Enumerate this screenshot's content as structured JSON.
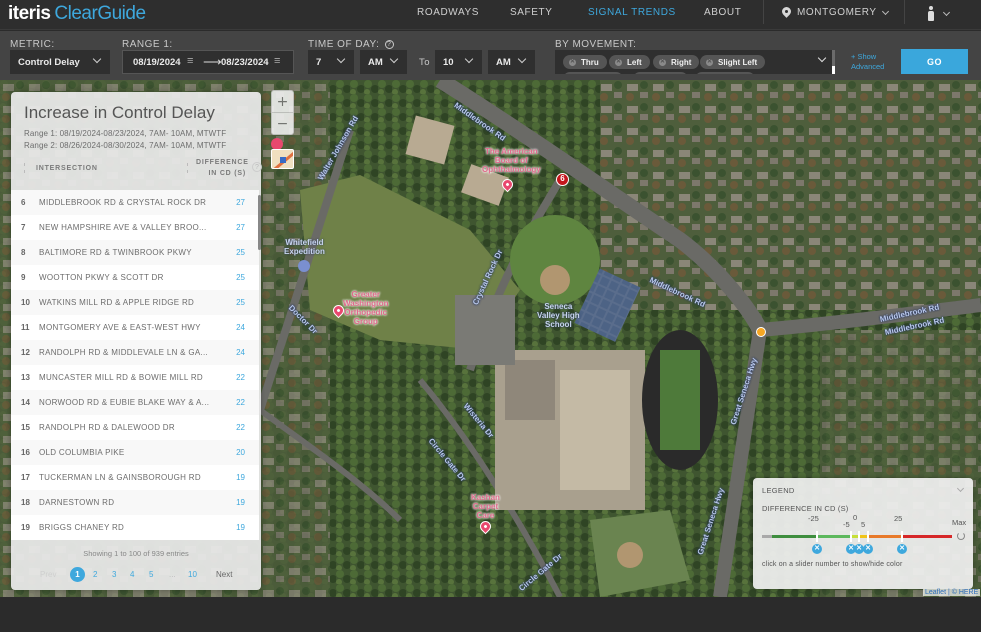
{
  "app": {
    "brand": "iteris",
    "product": "ClearGuide"
  },
  "nav": {
    "items": [
      {
        "label": "ROADWAYS",
        "active": false
      },
      {
        "label": "SAFETY",
        "active": false
      },
      {
        "label": "SIGNAL TRENDS",
        "active": true
      },
      {
        "label": "ABOUT",
        "active": false
      }
    ],
    "location": "MONTGOMERY",
    "location_icon": "map-pin-icon",
    "user_icon": "user-icon"
  },
  "filters": {
    "metric_label": "METRIC:",
    "metric_value": "Control Delay",
    "range_label": "RANGE 1:",
    "range_start": "08/19/2024",
    "range_end": "08/23/2024",
    "range_arrow": "⟶",
    "calendar_glyph": "≡",
    "time_label": "TIME OF DAY:",
    "time_help": "?",
    "from_hour": "7",
    "from_ampm": "AM",
    "to_label": "To",
    "to_hour": "10",
    "to_ampm": "AM",
    "movement_label": "BY MOVEMENT:",
    "movements": [
      "Thru",
      "Left",
      "Right",
      "Slight Left"
    ],
    "show_advanced": "+ Show Advanced",
    "go_label": "GO"
  },
  "panel": {
    "title": "Increase in Control Delay",
    "range1": "Range 1: 08/19/2024-08/23/2024, 7AM- 10AM, MTWTF",
    "range2": "Range 2: 08/26/2024-08/30/2024, 7AM- 10AM, MTWTF",
    "col_intersection": "INTERSECTION",
    "col_difference_1": "DIFFERENCE",
    "col_difference_2": "IN CD (S)",
    "help": "?",
    "rows": [
      {
        "rank": "6",
        "name": "MIDDLEBROOK RD & CRYSTAL ROCK DR",
        "value": "27"
      },
      {
        "rank": "7",
        "name": "NEW HAMPSHIRE AVE & VALLEY BROO...",
        "value": "27"
      },
      {
        "rank": "8",
        "name": "BALTIMORE RD & TWINBROOK PKWY",
        "value": "25"
      },
      {
        "rank": "9",
        "name": "WOOTTON PKWY & SCOTT DR",
        "value": "25"
      },
      {
        "rank": "10",
        "name": "WATKINS MILL RD & APPLE RIDGE RD",
        "value": "25"
      },
      {
        "rank": "11",
        "name": "MONTGOMERY AVE & EAST-WEST HWY",
        "value": "24"
      },
      {
        "rank": "12",
        "name": "RANDOLPH RD & MIDDLEVALE LN & GA...",
        "value": "24"
      },
      {
        "rank": "13",
        "name": "MUNCASTER MILL RD & BOWIE MILL RD",
        "value": "22"
      },
      {
        "rank": "14",
        "name": "NORWOOD RD & EUBIE BLAKE WAY & A...",
        "value": "22"
      },
      {
        "rank": "15",
        "name": "RANDOLPH RD & DALEWOOD DR",
        "value": "22"
      },
      {
        "rank": "16",
        "name": "OLD COLUMBIA PIKE",
        "value": "20"
      },
      {
        "rank": "17",
        "name": "TUCKERMAN LN & GAINSBOROUGH RD",
        "value": "19"
      },
      {
        "rank": "18",
        "name": "DARNESTOWN RD",
        "value": "19"
      },
      {
        "rank": "19",
        "name": "BRIGGS CHANEY RD",
        "value": "19"
      }
    ],
    "showing": "Showing 1 to 100 of 939 entries",
    "pager": {
      "prev": "Prev",
      "pages": [
        "1",
        "2",
        "3",
        "4",
        "5"
      ],
      "current": "1",
      "ellipsis": "...",
      "last": "10",
      "next": "Next"
    }
  },
  "map": {
    "zoom_in": "+",
    "zoom_out": "−",
    "selected_marker": "6",
    "road_labels": [
      "Middlebrook Rd",
      "Middlebrook Rd",
      "Middlebrook Rd",
      "Middlebrook Rd",
      "Walter Johnson Rd",
      "Crystal Rock Dr",
      "Great Seneca Hwy",
      "Great Seneca Hwy",
      "Doctor Dr",
      "Wisteria Dr",
      "Circle Gate Dr",
      "Circle Gate Dr"
    ],
    "pois": [
      {
        "label": "The American\nBoard of\nOphthalmology"
      },
      {
        "label": "Greater\nWashington\nOrthopedic\nGroup"
      },
      {
        "label": "Seneca\nValley High\nSchool"
      },
      {
        "label": "Kashan\nCarpet\nCare"
      },
      {
        "label": "Whitefield\nExpedition"
      }
    ],
    "attribution": "Leaflet | © HERE"
  },
  "legend": {
    "title": "LEGEND",
    "subtitle": "DIFFERENCE IN CD (S)",
    "ticks": [
      "-25",
      "-5",
      "0",
      "5",
      "25",
      "Max"
    ],
    "colors": {
      "min": "#a9a9a9",
      "dark_green": "#3e8e3e",
      "green": "#5cb85c",
      "yellow_green": "#c6e03a",
      "yellow": "#f0c419",
      "orange": "#e87a2a",
      "red": "#d62728"
    },
    "remove_glyph": "✕",
    "hint": "click on a slider number to show/hide color"
  },
  "colors": {
    "accent": "#3ea8dd",
    "header_bg": "#2e2e2e",
    "filterbar_bg": "#444444",
    "marker_red": "#c4161c",
    "marker_orange": "#f5a623"
  }
}
